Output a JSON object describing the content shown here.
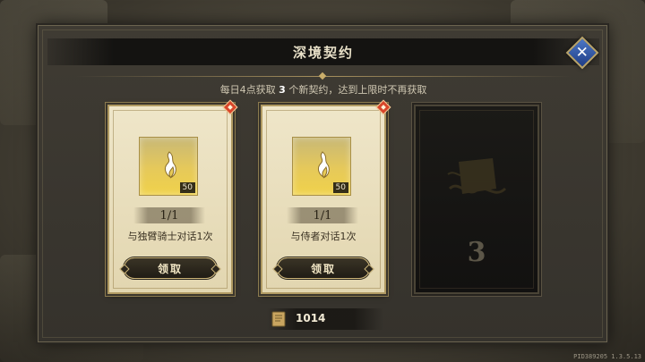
{
  "dialog": {
    "title": "深境契约",
    "info_prefix": "每日4点获取 ",
    "info_count": "3",
    "info_suffix": " 个新契约，达到上限时不再获取"
  },
  "cards": [
    {
      "progress": "1/1",
      "task": "与独臂骑士对话1次",
      "item_count": "50",
      "claim_label": "领取",
      "new_badge": true
    },
    {
      "progress": "1/1",
      "task": "与侍者对话1次",
      "item_count": "50",
      "claim_label": "领取",
      "new_badge": true
    }
  ],
  "locked_card": {
    "number": "3"
  },
  "currency": {
    "value": "1014",
    "icon": "contract-scroll-icon"
  },
  "footer": {
    "version": "PID389205  1.3.5.13"
  },
  "colors": {
    "accent_gold": "#cdb67a",
    "close_blue": "#2f58a8",
    "badge_red": "#d8462a"
  }
}
